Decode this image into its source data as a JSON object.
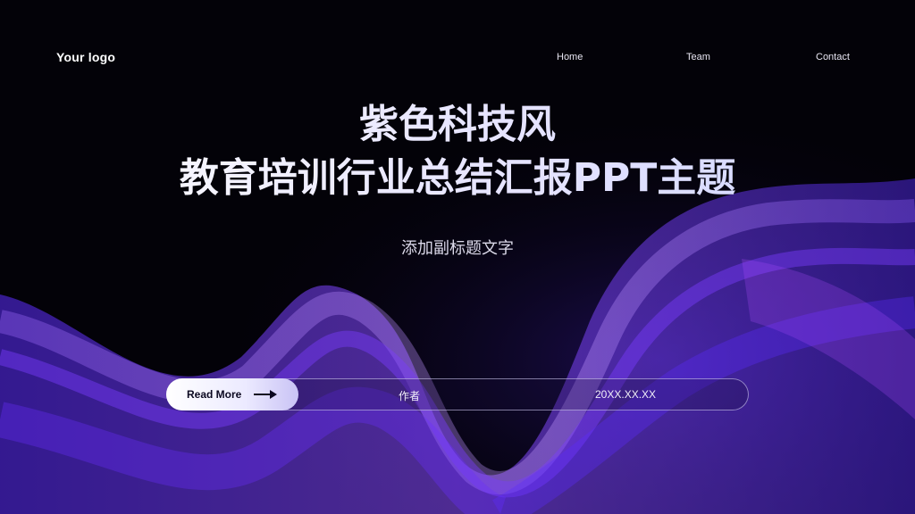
{
  "header": {
    "logo": "Your logo"
  },
  "nav": {
    "items": [
      "Home",
      "Team",
      "Contact"
    ]
  },
  "hero": {
    "title_line1": "紫色科技风",
    "title_line2": "教育培训行业总结汇报PPT主题",
    "subtitle": "添加副标题文字"
  },
  "info_bar": {
    "button_label": "Read More",
    "author": "作者",
    "date": "20XX.XX.XX"
  },
  "colors": {
    "background": "#030208",
    "accent": "#7b3cff",
    "wave_light": "#b07cff"
  },
  "icons": {
    "button_icon": "arrow-right-icon"
  }
}
